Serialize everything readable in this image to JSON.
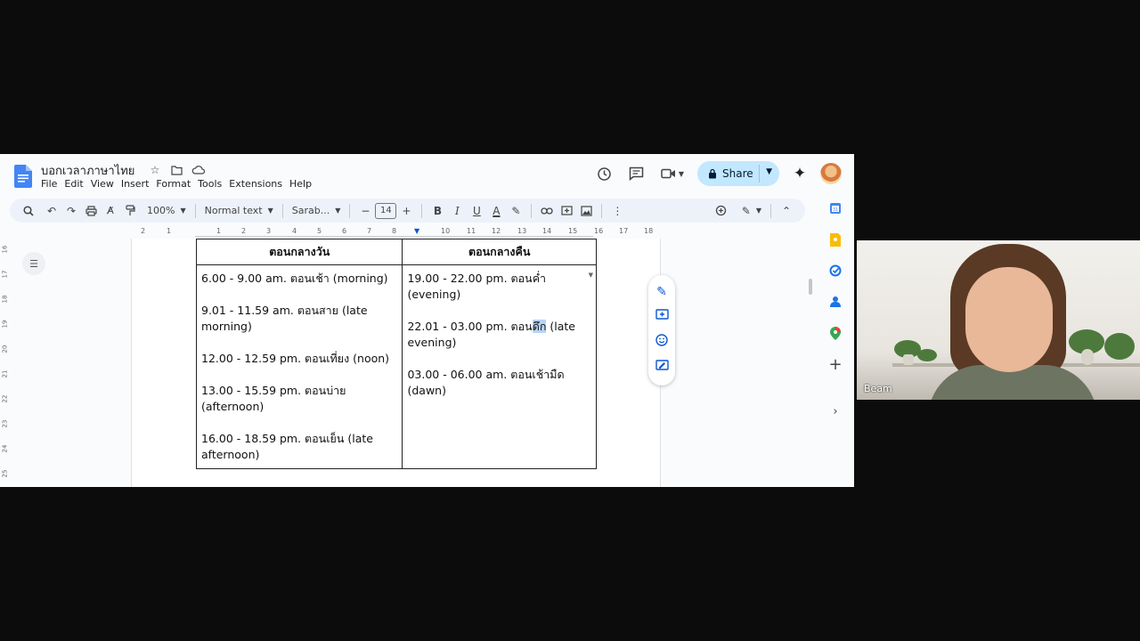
{
  "doc": {
    "title": "บอกเวลาภาษาไทย",
    "menu": [
      "File",
      "Edit",
      "View",
      "Insert",
      "Format",
      "Tools",
      "Extensions",
      "Help"
    ],
    "share_label": "Share"
  },
  "toolbar": {
    "zoom": "100%",
    "style": "Normal text",
    "font": "Sarab...",
    "font_size": "14",
    "minus": "−",
    "plus": "+",
    "bold": "B",
    "italic": "I",
    "underline": "U",
    "text_color": "A"
  },
  "ruler": {
    "h_ticks": [
      "2",
      "1",
      "1",
      "2",
      "3",
      "4",
      "5",
      "6",
      "7",
      "8",
      "9",
      "10",
      "11",
      "12",
      "13",
      "14",
      "15",
      "16",
      "17",
      "18"
    ],
    "v_ticks": [
      "16",
      "17",
      "18",
      "19",
      "20",
      "21",
      "22",
      "23",
      "24",
      "25"
    ]
  },
  "table": {
    "headers": [
      "ตอนกลางวัน",
      "ตอนกลางคืน"
    ],
    "day": [
      "6.00 - 9.00 am. ตอนเช้า (morning)",
      "9.01 - 11.59 am. ตอนสาย (late morning)",
      "12.00 - 12.59 pm. ตอนเที่ยง (noon)",
      "13.00 - 15.59 pm. ตอนบ่าย (afternoon)",
      "16.00 - 18.59 pm. ตอนเย็น (late afternoon)"
    ],
    "night": {
      "row1": "19.00 - 22.00 pm. ตอนค่ำ (evening)",
      "row2_pre": "22.01 - 03.00 pm. ตอน",
      "row2_sel": "ดึก",
      "row2_post": " (late evening)",
      "row3": "03.00 - 06.00 am. ตอนเช้ามืด (dawn)"
    }
  },
  "video": {
    "participant_name": "Beam"
  },
  "colors": {
    "share_bg": "#c2e7ff",
    "accent": "#0b57d0",
    "selection": "#b6d4f7"
  }
}
